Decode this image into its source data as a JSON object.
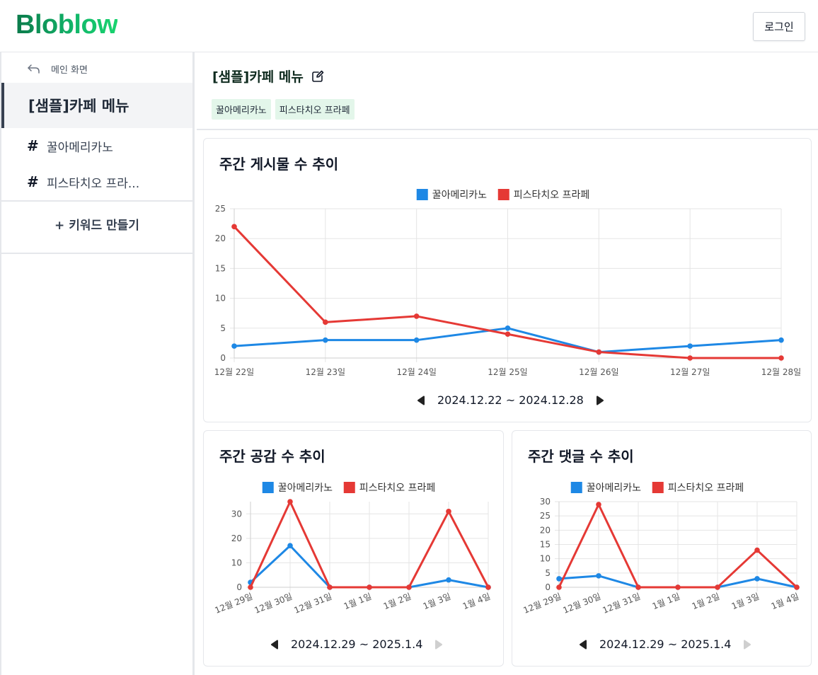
{
  "header": {
    "logo": "Bloblow",
    "login_label": "로그인"
  },
  "sidebar": {
    "back_label": "메인 화면",
    "group_name": "[샘플]카페 메뉴",
    "keywords": [
      {
        "hash": "#",
        "label": "꿀아메리카노"
      },
      {
        "hash": "#",
        "label": "피스타치오 프라..."
      }
    ],
    "make_keyword_label": "+ 키워드 만들기"
  },
  "main": {
    "title": "[샘플]카페 메뉴",
    "tags": [
      "꿀아메리카노",
      "피스타치오 프라페"
    ]
  },
  "colors": {
    "series_blue": "#1e88e5",
    "series_red": "#e53935",
    "grid": "#e5e5e5",
    "axis_text": "#555555"
  },
  "chart_data": [
    {
      "type": "line",
      "title": "주간 게시물 수 추이",
      "legend_position": "top",
      "categories": [
        "12월 22일",
        "12월 23일",
        "12월 24일",
        "12월 25일",
        "12월 26일",
        "12월 27일",
        "12월 28일"
      ],
      "series": [
        {
          "name": "꿀아메리카노",
          "color": "#1e88e5",
          "values": [
            2,
            3,
            3,
            5,
            1,
            2,
            3
          ]
        },
        {
          "name": "피스타치오 프라페",
          "color": "#e53935",
          "values": [
            22,
            6,
            7,
            4,
            1,
            0,
            0
          ]
        }
      ],
      "ylim": [
        0,
        25
      ],
      "yticks": [
        0,
        5,
        10,
        15,
        20,
        25
      ],
      "grid": true,
      "range_label": "2024.12.22 ~ 2024.12.28",
      "next_enabled": true
    },
    {
      "type": "line",
      "title": "주간 공감 수 추이",
      "legend_position": "top",
      "categories": [
        "12월 29일",
        "12월 30일",
        "12월 31일",
        "1월 1일",
        "1월 2일",
        "1월 3일",
        "1월 4일"
      ],
      "series": [
        {
          "name": "꿀아메리카노",
          "color": "#1e88e5",
          "values": [
            2,
            17,
            0,
            0,
            0,
            3,
            0
          ]
        },
        {
          "name": "피스타치오 프라페",
          "color": "#e53935",
          "values": [
            0,
            35,
            0,
            0,
            0,
            31,
            0
          ]
        }
      ],
      "ylim": [
        0,
        35
      ],
      "yticks": [
        0,
        10,
        20,
        30
      ],
      "grid": true,
      "range_label": "2024.12.29 ~ 2025.1.4",
      "next_enabled": false
    },
    {
      "type": "line",
      "title": "주간 댓글 수 추이",
      "legend_position": "top",
      "categories": [
        "12월 29일",
        "12월 30일",
        "12월 31일",
        "1월 1일",
        "1월 2일",
        "1월 3일",
        "1월 4일"
      ],
      "series": [
        {
          "name": "꿀아메리카노",
          "color": "#1e88e5",
          "values": [
            3,
            4,
            0,
            0,
            0,
            3,
            0
          ]
        },
        {
          "name": "피스타치오 프라페",
          "color": "#e53935",
          "values": [
            0,
            29,
            0,
            0,
            0,
            13,
            0
          ]
        }
      ],
      "ylim": [
        0,
        30
      ],
      "yticks": [
        0,
        5,
        10,
        15,
        20,
        25,
        30
      ],
      "grid": true,
      "range_label": "2024.12.29 ~ 2025.1.4",
      "next_enabled": false
    }
  ]
}
